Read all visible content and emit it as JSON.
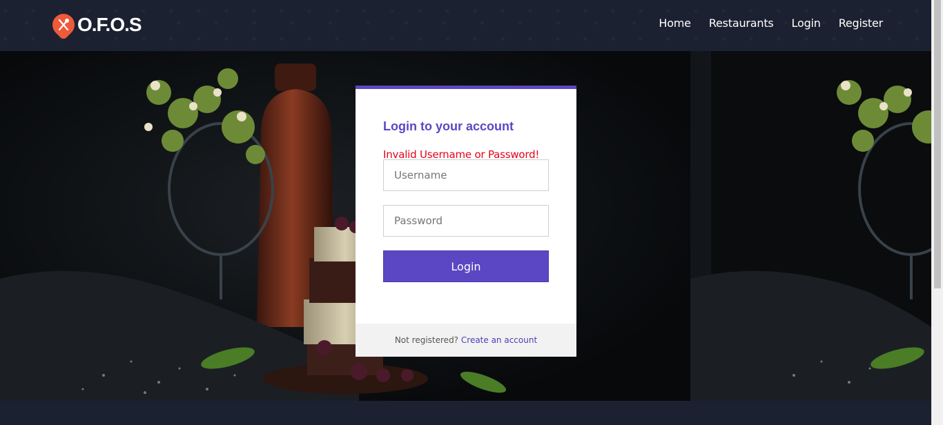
{
  "brand": {
    "name": "O.F.O.S",
    "icon": "cutlery-icon",
    "color": "#ee5a3a"
  },
  "nav": [
    {
      "label": "Home"
    },
    {
      "label": "Restaurants"
    },
    {
      "label": "Login"
    },
    {
      "label": "Register"
    }
  ],
  "login": {
    "title": "Login to your account",
    "error": "Invalid Username or Password!",
    "username_placeholder": "Username",
    "password_placeholder": "Password",
    "submit_label": "Login",
    "footer_text": "Not registered?",
    "footer_link": "Create an account",
    "accent_color": "#5b47c3",
    "error_color": "#e8001a"
  }
}
